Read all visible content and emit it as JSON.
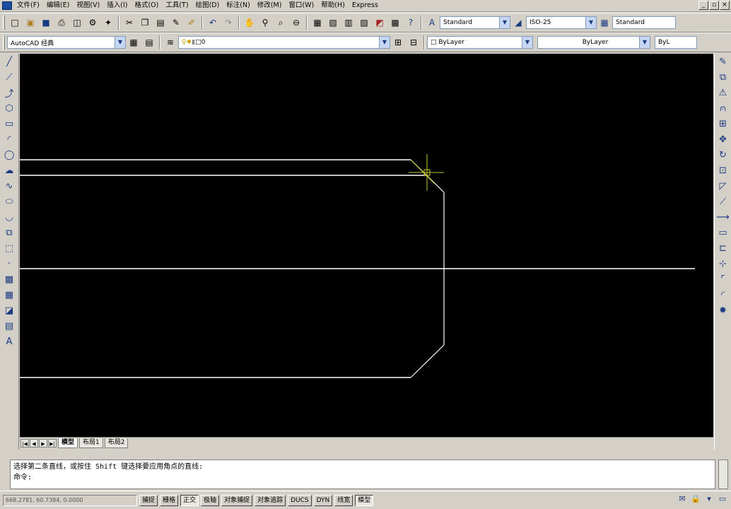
{
  "menu": [
    "文件(F)",
    "编辑(E)",
    "视图(V)",
    "插入(I)",
    "格式(O)",
    "工具(T)",
    "绘图(D)",
    "标注(N)",
    "修改(M)",
    "窗口(W)",
    "帮助(H)",
    "Express"
  ],
  "window_controls": [
    "_",
    "▫",
    "×"
  ],
  "toolbar1": {
    "text_style": "Standard",
    "dim_style": "ISO-25",
    "table_style": "Standard"
  },
  "toolbar2": {
    "workspace": "AutoCAD 经典",
    "layer": "0",
    "color": "ByLayer",
    "linetype": "ByLayer",
    "lineweight": "ByL"
  },
  "layout_tabs": [
    "模型",
    "布局1",
    "布局2"
  ],
  "active_tab": "模型",
  "command": {
    "line1": "选择第二条直线，或按住 Shift 键选择要应用角点的直线:",
    "line2": "命令:"
  },
  "status": {
    "coords": "668.2781, 60.7384, 0.0000",
    "buttons": [
      "捕捉",
      "栅格",
      "正交",
      "极轴",
      "对象捕捉",
      "对象追踪",
      "DUCS",
      "DYN",
      "线宽",
      "模型"
    ],
    "active_buttons": [
      "正交",
      "模型"
    ]
  },
  "colors": {
    "canvas": "#000000",
    "lines": "#ffffff",
    "cursor": "#c8c832",
    "ui": "#d4d0c8"
  },
  "icons": {
    "left": [
      "line-icon",
      "construction-line-icon",
      "polyline-icon",
      "polygon-icon",
      "rectangle-icon",
      "arc-icon",
      "circle-icon",
      "revision-cloud-icon",
      "spline-icon",
      "ellipse-icon",
      "ellipse-arc-icon",
      "insert-block-icon",
      "make-block-icon",
      "point-icon",
      "hatch-icon",
      "gradient-icon",
      "region-icon",
      "table-icon",
      "multiline-text-icon"
    ],
    "right": [
      "erase-icon",
      "copy-icon",
      "mirror-icon",
      "offset-icon",
      "array-icon",
      "move-icon",
      "rotate-icon",
      "scale-icon",
      "stretch-icon",
      "trim-icon",
      "extend-icon",
      "break-at-point-icon",
      "break-icon",
      "join-icon",
      "chamfer-icon",
      "fillet-icon",
      "explode-icon"
    ]
  }
}
